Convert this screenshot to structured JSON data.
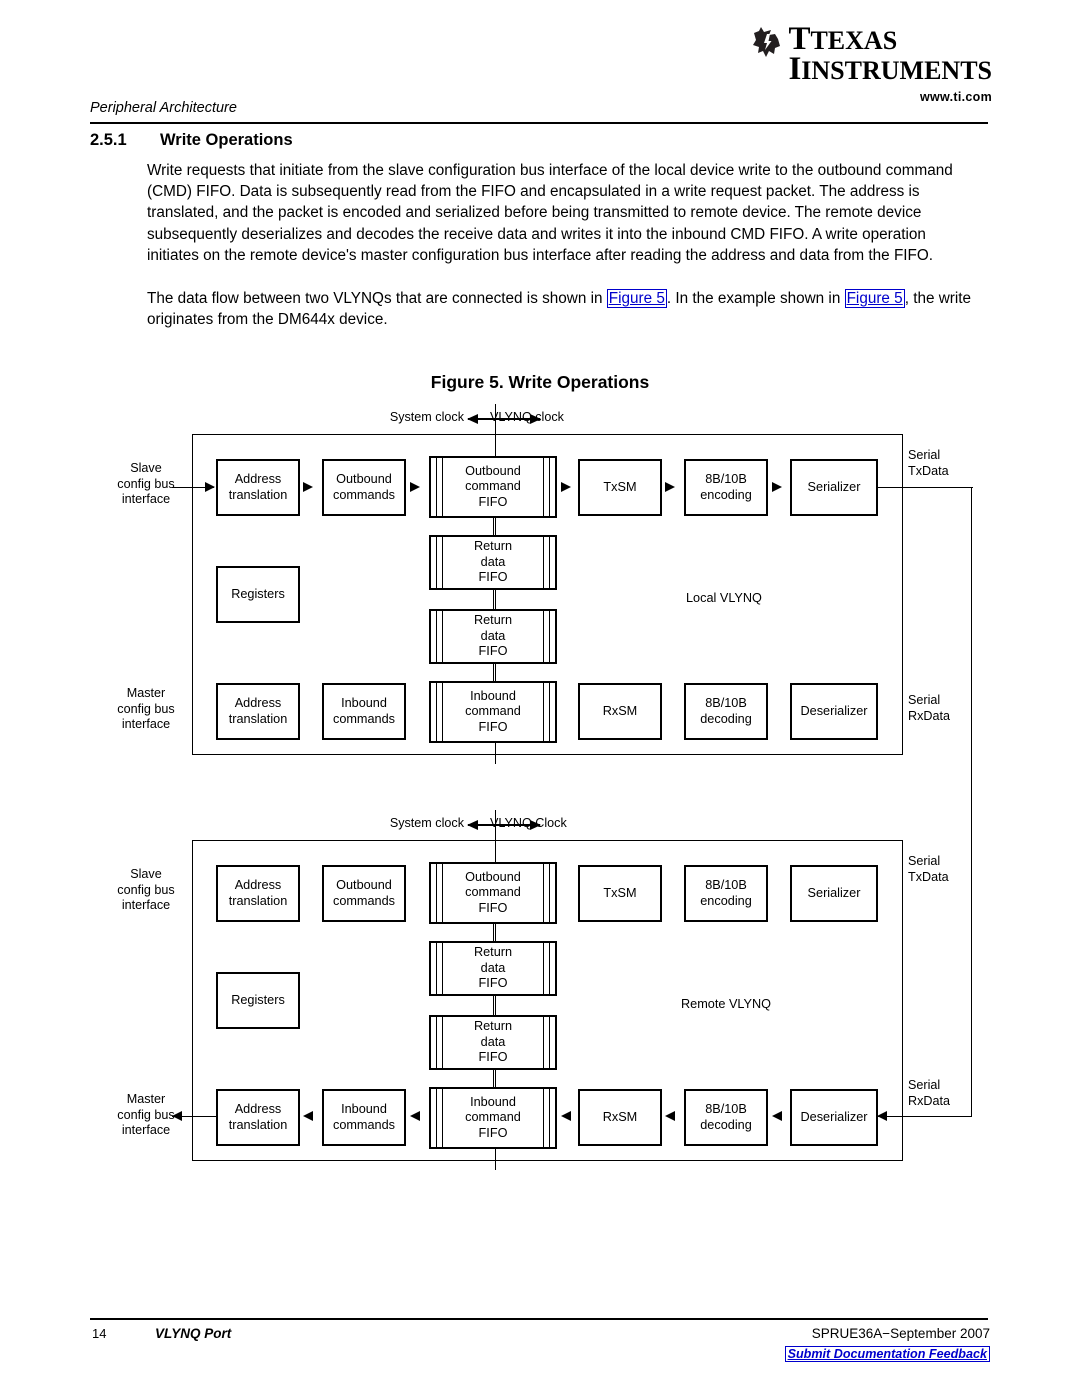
{
  "brand": {
    "name_line1": "TEXAS",
    "name_line2": "INSTRUMENTS",
    "url": "www.ti.com"
  },
  "header": {
    "running_head": "Peripheral Architecture",
    "section_number": "2.5.1",
    "section_title": "Write Operations"
  },
  "body": {
    "paragraph1": "Write requests that initiate from the slave configuration bus interface of the local device write to the outbound command (CMD) FIFO. Data is subsequently read from the FIFO and encapsulated in a write request packet. The address is translated, and the packet is encoded and serialized before being transmitted to remote device. The remote device subsequently deserializes and decodes the receive data and writes it into the inbound CMD FIFO. A write operation initiates on the remote device's master configuration bus interface after reading the address and data from the FIFO.",
    "paragraph2_part1": "The data flow between two VLYNQs that are connected is shown in ",
    "xref1": "Figure 5",
    "paragraph2_part2": ". In the example shown in ",
    "xref2": "Figure 5",
    "paragraph2_part3": ", the write originates from the DM644x device."
  },
  "figure": {
    "caption": "Figure 5. Write Operations",
    "local": {
      "clock_left": "System clock",
      "clock_right": "VLYNQ clock",
      "area_label": "Local VLYNQ",
      "slave_bus": "Slave\nconfig bus\ninterface",
      "master_bus": "Master\nconfig bus\ninterface",
      "serial_tx": "Serial\nTxData",
      "serial_rx": "Serial\nRxData",
      "tx_chain": [
        "Address\ntranslation",
        "Outbound\ncommands",
        "Outbound\ncommand\nFIFO",
        "TxSM",
        "8B/10B\nencoding",
        "Serializer"
      ],
      "rx_chain": [
        "Address\ntranslation",
        "Inbound\ncommands",
        "Inbound\ncommand\nFIFO",
        "RxSM",
        "8B/10B\ndecoding",
        "Deserializer"
      ],
      "registers": "Registers",
      "return_fifo_1": "Return\ndata\nFIFO",
      "return_fifo_2": "Return\ndata\nFIFO"
    },
    "remote": {
      "clock_left": "System clock",
      "clock_right": "VLYNQ Clock",
      "area_label": "Remote VLYNQ",
      "slave_bus": "Slave\nconfig bus\ninterface",
      "master_bus": "Master\nconfig bus\ninterface",
      "serial_tx": "Serial\nTxData",
      "serial_rx": "Serial\nRxData",
      "tx_chain": [
        "Address\ntranslation",
        "Outbound\ncommands",
        "Outbound\ncommand\nFIFO",
        "TxSM",
        "8B/10B\nencoding",
        "Serializer"
      ],
      "rx_chain": [
        "Address\ntranslation",
        "Inbound\ncommands",
        "Inbound\ncommand\nFIFO",
        "RxSM",
        "8B/10B\ndecoding",
        "Deserializer"
      ],
      "registers": "Registers",
      "return_fifo_1": "Return\ndata\nFIFO",
      "return_fifo_2": "Return\ndata\nFIFO"
    }
  },
  "footer": {
    "page_number": "14",
    "doc_title": "VLYNQ Port",
    "doc_id": "SPRUE36A−September 2007",
    "feedback_link": "Submit Documentation Feedback"
  },
  "colors": {
    "link": "#0000cc",
    "rule": "#000000"
  }
}
